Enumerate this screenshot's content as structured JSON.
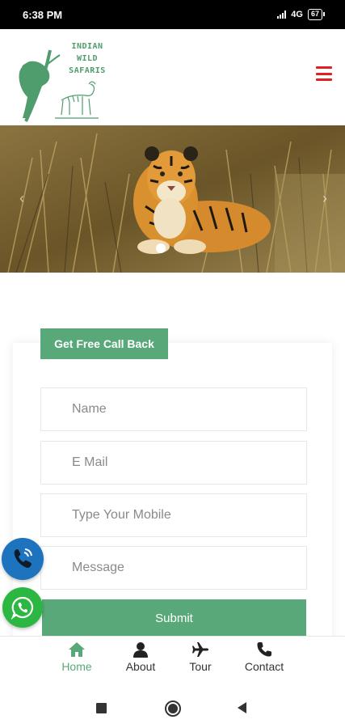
{
  "status_bar": {
    "time": "6:38 PM",
    "network": "4G",
    "battery": "67"
  },
  "header": {
    "logo_text": "INDIAN WILD SAFARIS",
    "menu_icon": "hamburger-icon"
  },
  "hero": {
    "prev_icon": "‹",
    "next_icon": "›"
  },
  "form": {
    "title": "Get Free Call Back",
    "name_placeholder": "Name",
    "email_placeholder": "E Mail",
    "mobile_placeholder": "Type Your Mobile",
    "message_placeholder": "Message",
    "submit_label": "Submit"
  },
  "floating": {
    "call_icon": "phone-call-icon",
    "whatsapp_icon": "whatsapp-icon"
  },
  "bottom_nav": {
    "items": [
      {
        "label": "Home",
        "icon": "home-icon",
        "active": true
      },
      {
        "label": "About",
        "icon": "user-icon",
        "active": false
      },
      {
        "label": "Tour",
        "icon": "plane-icon",
        "active": false
      },
      {
        "label": "Contact",
        "icon": "phone-icon",
        "active": false
      }
    ]
  },
  "colors": {
    "brand_green": "#58a879",
    "menu_red": "#e02020",
    "call_blue": "#1e73be",
    "whatsapp_green": "#2bb741"
  }
}
